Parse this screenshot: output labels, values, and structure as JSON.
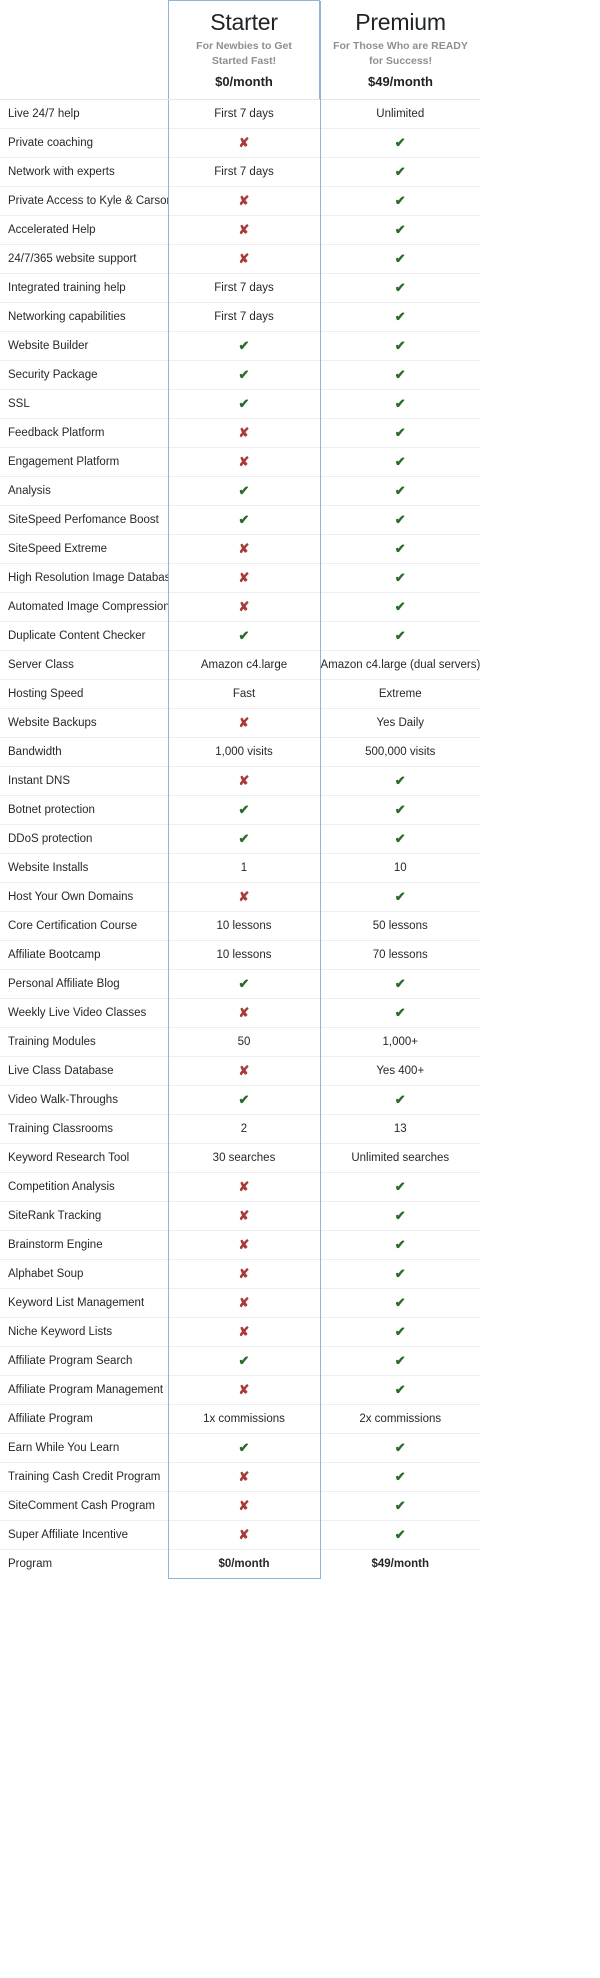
{
  "colors": {
    "accent_border": "#8fb4d9",
    "check": "#2d6a2d",
    "cross": "#a83a3a",
    "row_divider": "#eceeef",
    "text": "#25282b",
    "muted_text": "#8c9093"
  },
  "columns": {
    "feature_header": "",
    "plans": [
      {
        "name": "Starter",
        "tagline": "For Newbies to Get Started Fast!",
        "price": "$0/month",
        "highlighted": true
      },
      {
        "name": "Premium",
        "tagline": "For Those Who are READY for Success!",
        "price": "$49/month",
        "highlighted": false
      }
    ]
  },
  "icons": {
    "check": "check-icon",
    "check_glyph": "✔",
    "cross": "cross-icon",
    "cross_glyph": "✘"
  },
  "rows": [
    {
      "feature": "Live 24/7 help",
      "starter": "First 7 days",
      "premium": "Unlimited"
    },
    {
      "feature": "Private coaching",
      "starter": "no",
      "premium": "yes"
    },
    {
      "feature": "Network with experts",
      "starter": "First 7 days",
      "premium": "yes"
    },
    {
      "feature": "Private Access to Kyle & Carson",
      "starter": "no",
      "premium": "yes"
    },
    {
      "feature": "Accelerated Help",
      "starter": "no",
      "premium": "yes"
    },
    {
      "feature": "24/7/365 website support",
      "starter": "no",
      "premium": "yes"
    },
    {
      "feature": "Integrated training help",
      "starter": "First 7 days",
      "premium": "yes"
    },
    {
      "feature": "Networking capabilities",
      "starter": "First 7 days",
      "premium": "yes"
    },
    {
      "feature": "Website Builder",
      "starter": "yes",
      "premium": "yes"
    },
    {
      "feature": "Security Package",
      "starter": "yes",
      "premium": "yes"
    },
    {
      "feature": "SSL",
      "starter": "yes",
      "premium": "yes"
    },
    {
      "feature": "Feedback Platform",
      "starter": "no",
      "premium": "yes"
    },
    {
      "feature": "Engagement Platform",
      "starter": "no",
      "premium": "yes"
    },
    {
      "feature": "Analysis",
      "starter": "yes",
      "premium": "yes"
    },
    {
      "feature": "SiteSpeed Perfomance Boost",
      "starter": "yes",
      "premium": "yes"
    },
    {
      "feature": "SiteSpeed Extreme",
      "starter": "no",
      "premium": "yes"
    },
    {
      "feature": "High Resolution Image Database",
      "starter": "no",
      "premium": "yes"
    },
    {
      "feature": "Automated Image Compression",
      "starter": "no",
      "premium": "yes"
    },
    {
      "feature": "Duplicate Content Checker",
      "starter": "yes",
      "premium": "yes"
    },
    {
      "feature": "Server Class",
      "starter": "Amazon c4.large",
      "premium": "Amazon c4.large (dual servers)"
    },
    {
      "feature": "Hosting Speed",
      "starter": "Fast",
      "premium": "Extreme"
    },
    {
      "feature": "Website Backups",
      "starter": "no",
      "premium": "Yes Daily"
    },
    {
      "feature": "Bandwidth",
      "starter": "1,000 visits",
      "premium": "500,000 visits"
    },
    {
      "feature": "Instant DNS",
      "starter": "no",
      "premium": "yes"
    },
    {
      "feature": "Botnet protection",
      "starter": "yes",
      "premium": "yes"
    },
    {
      "feature": "DDoS protection",
      "starter": "yes",
      "premium": "yes"
    },
    {
      "feature": "Website Installs",
      "starter": "1",
      "premium": "10"
    },
    {
      "feature": "Host Your Own Domains",
      "starter": "no",
      "premium": "yes"
    },
    {
      "feature": "Core Certification Course",
      "starter": "10 lessons",
      "premium": "50 lessons"
    },
    {
      "feature": "Affiliate Bootcamp",
      "starter": "10 lessons",
      "premium": "70 lessons"
    },
    {
      "feature": "Personal Affiliate Blog",
      "starter": "yes",
      "premium": "yes"
    },
    {
      "feature": "Weekly Live Video Classes",
      "starter": "no",
      "premium": "yes"
    },
    {
      "feature": "Training Modules",
      "starter": "50",
      "premium": "1,000+"
    },
    {
      "feature": "Live Class Database",
      "starter": "no",
      "premium": "Yes 400+"
    },
    {
      "feature": "Video Walk-Throughs",
      "starter": "yes",
      "premium": "yes"
    },
    {
      "feature": "Training Classrooms",
      "starter": "2",
      "premium": "13"
    },
    {
      "feature": "Keyword Research Tool",
      "starter": "30 searches",
      "premium": "Unlimited searches"
    },
    {
      "feature": "Competition Analysis",
      "starter": "no",
      "premium": "yes"
    },
    {
      "feature": "SiteRank Tracking",
      "starter": "no",
      "premium": "yes"
    },
    {
      "feature": "Brainstorm Engine",
      "starter": "no",
      "premium": "yes"
    },
    {
      "feature": "Alphabet Soup",
      "starter": "no",
      "premium": "yes"
    },
    {
      "feature": "Keyword List Management",
      "starter": "no",
      "premium": "yes"
    },
    {
      "feature": "Niche Keyword Lists",
      "starter": "no",
      "premium": "yes"
    },
    {
      "feature": "Affiliate Program Search",
      "starter": "yes",
      "premium": "yes"
    },
    {
      "feature": "Affiliate Program Management",
      "starter": "no",
      "premium": "yes"
    },
    {
      "feature": "Affiliate Program",
      "starter": "1x commissions",
      "premium": "2x commissions"
    },
    {
      "feature": "Earn While You Learn",
      "starter": "yes",
      "premium": "yes"
    },
    {
      "feature": "Training Cash Credit Program",
      "starter": "no",
      "premium": "yes"
    },
    {
      "feature": "SiteComment Cash Program",
      "starter": "no",
      "premium": "yes"
    },
    {
      "feature": "Super Affiliate Incentive",
      "starter": "no",
      "premium": "yes"
    },
    {
      "feature": "Program",
      "starter": "$0/month",
      "premium": "$49/month"
    }
  ]
}
